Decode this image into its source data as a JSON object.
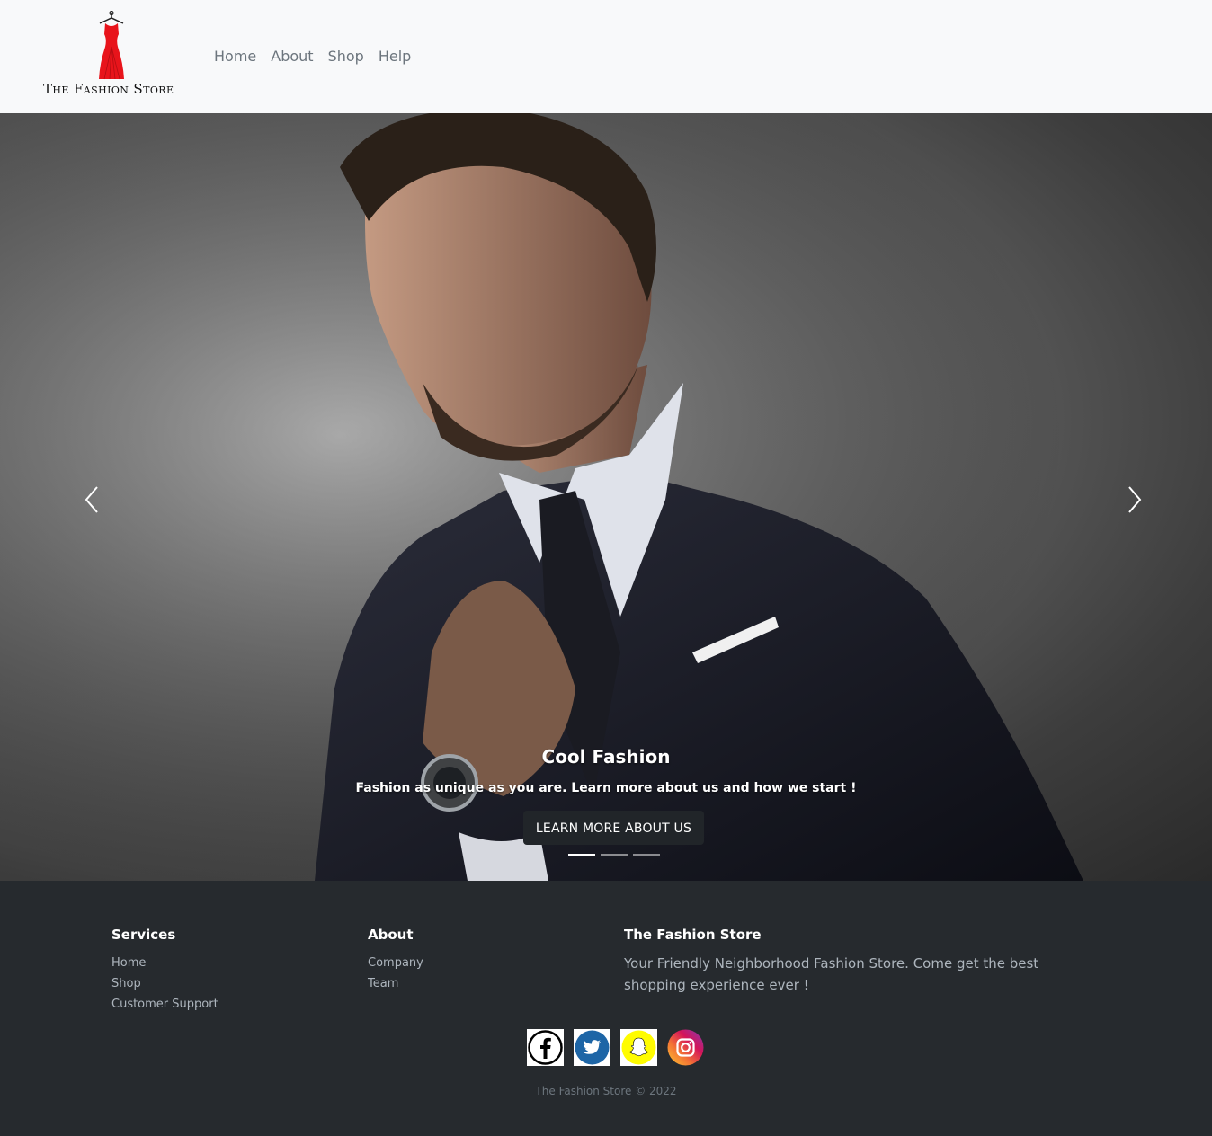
{
  "brand": {
    "name": "The Fashion Store"
  },
  "nav": {
    "items": [
      "Home",
      "About",
      "Shop",
      "Help"
    ]
  },
  "hero": {
    "caption_title": "Cool Fashion",
    "caption_text": "Fashion as unique as you are. Learn more about us and how we start !",
    "button_label": "LEARN MORE ABOUT US",
    "slide_count": 3,
    "active_slide": 1
  },
  "footer": {
    "services": {
      "title": "Services",
      "links": [
        "Home",
        "Shop",
        "Customer Support"
      ]
    },
    "about": {
      "title": "About",
      "links": [
        "Company",
        "Team"
      ]
    },
    "store": {
      "title": "The Fashion Store",
      "text": "Your Friendly Neighborhood Fashion Store. Come get the best shopping experience ever !"
    },
    "social": [
      "facebook-icon",
      "twitter-icon",
      "snapchat-icon",
      "instagram-icon"
    ],
    "copyright": "The Fashion Store © 2022"
  },
  "colors": {
    "navbar_bg": "#f8f9fa",
    "footer_bg": "#262a2e",
    "nav_link": "#6c757d",
    "logo_dress": "#e8141b",
    "button_bg": "#212529"
  }
}
